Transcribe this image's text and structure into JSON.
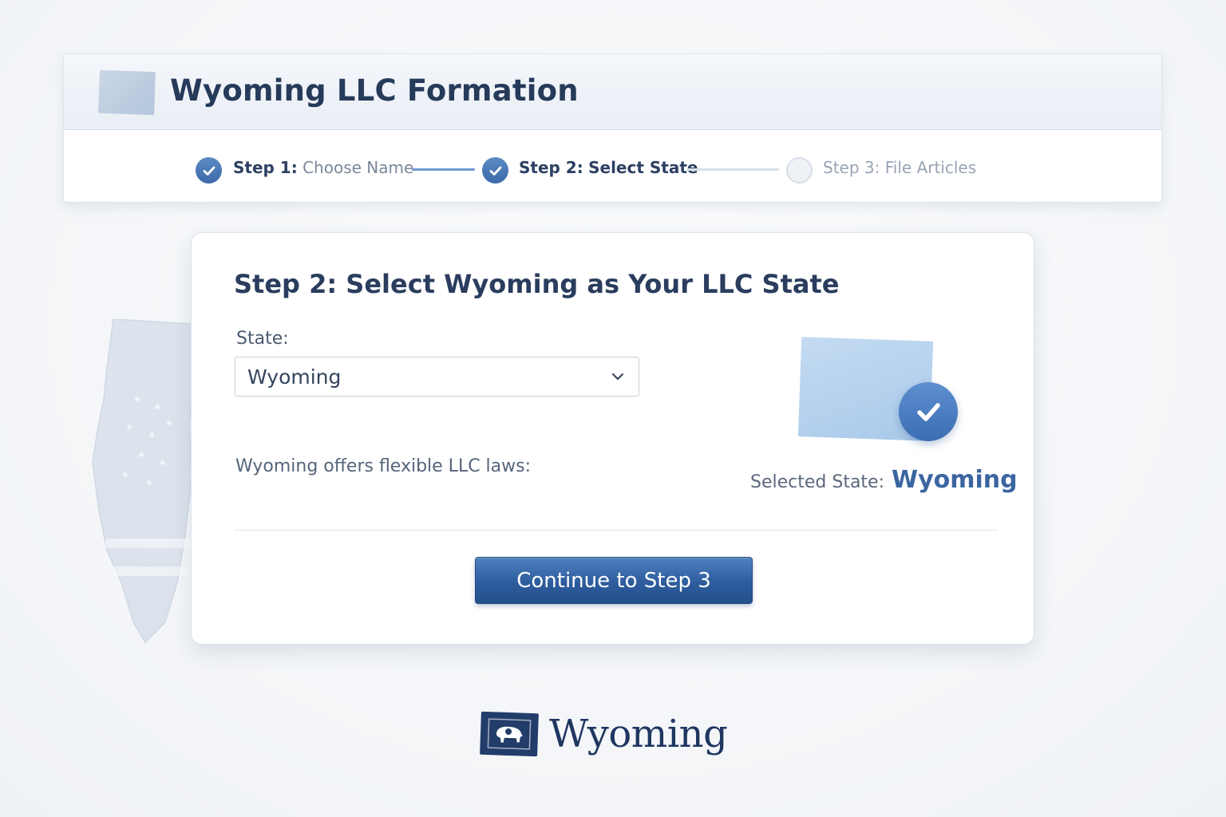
{
  "header": {
    "title": "Wyoming LLC Formation"
  },
  "stepper": {
    "steps": [
      {
        "prefix": "Step 1:",
        "name": "Choose Name",
        "status": "complete"
      },
      {
        "prefix": "Step 2:",
        "name": "Select State",
        "status": "current"
      },
      {
        "prefix": "Step 3:",
        "name": "File Articles",
        "status": "pending"
      }
    ]
  },
  "card": {
    "title": "Step 2: Select Wyoming as Your LLC State",
    "state_label": "State:",
    "state_value": "Wyoming",
    "description": "Wyoming offers flexible LLC laws:",
    "selected_label": "Selected State:",
    "selected_value": "Wyoming",
    "continue_label": "Continue to Step 3"
  },
  "logo": {
    "text": "Wyoming"
  },
  "colors": {
    "accent": "#3d6aa8",
    "button": "#2e5d9e",
    "title": "#263a5a"
  },
  "icons": [
    "check-icon",
    "chevron-down-icon",
    "wyoming-state-icon",
    "wyoming-flag-icon"
  ]
}
